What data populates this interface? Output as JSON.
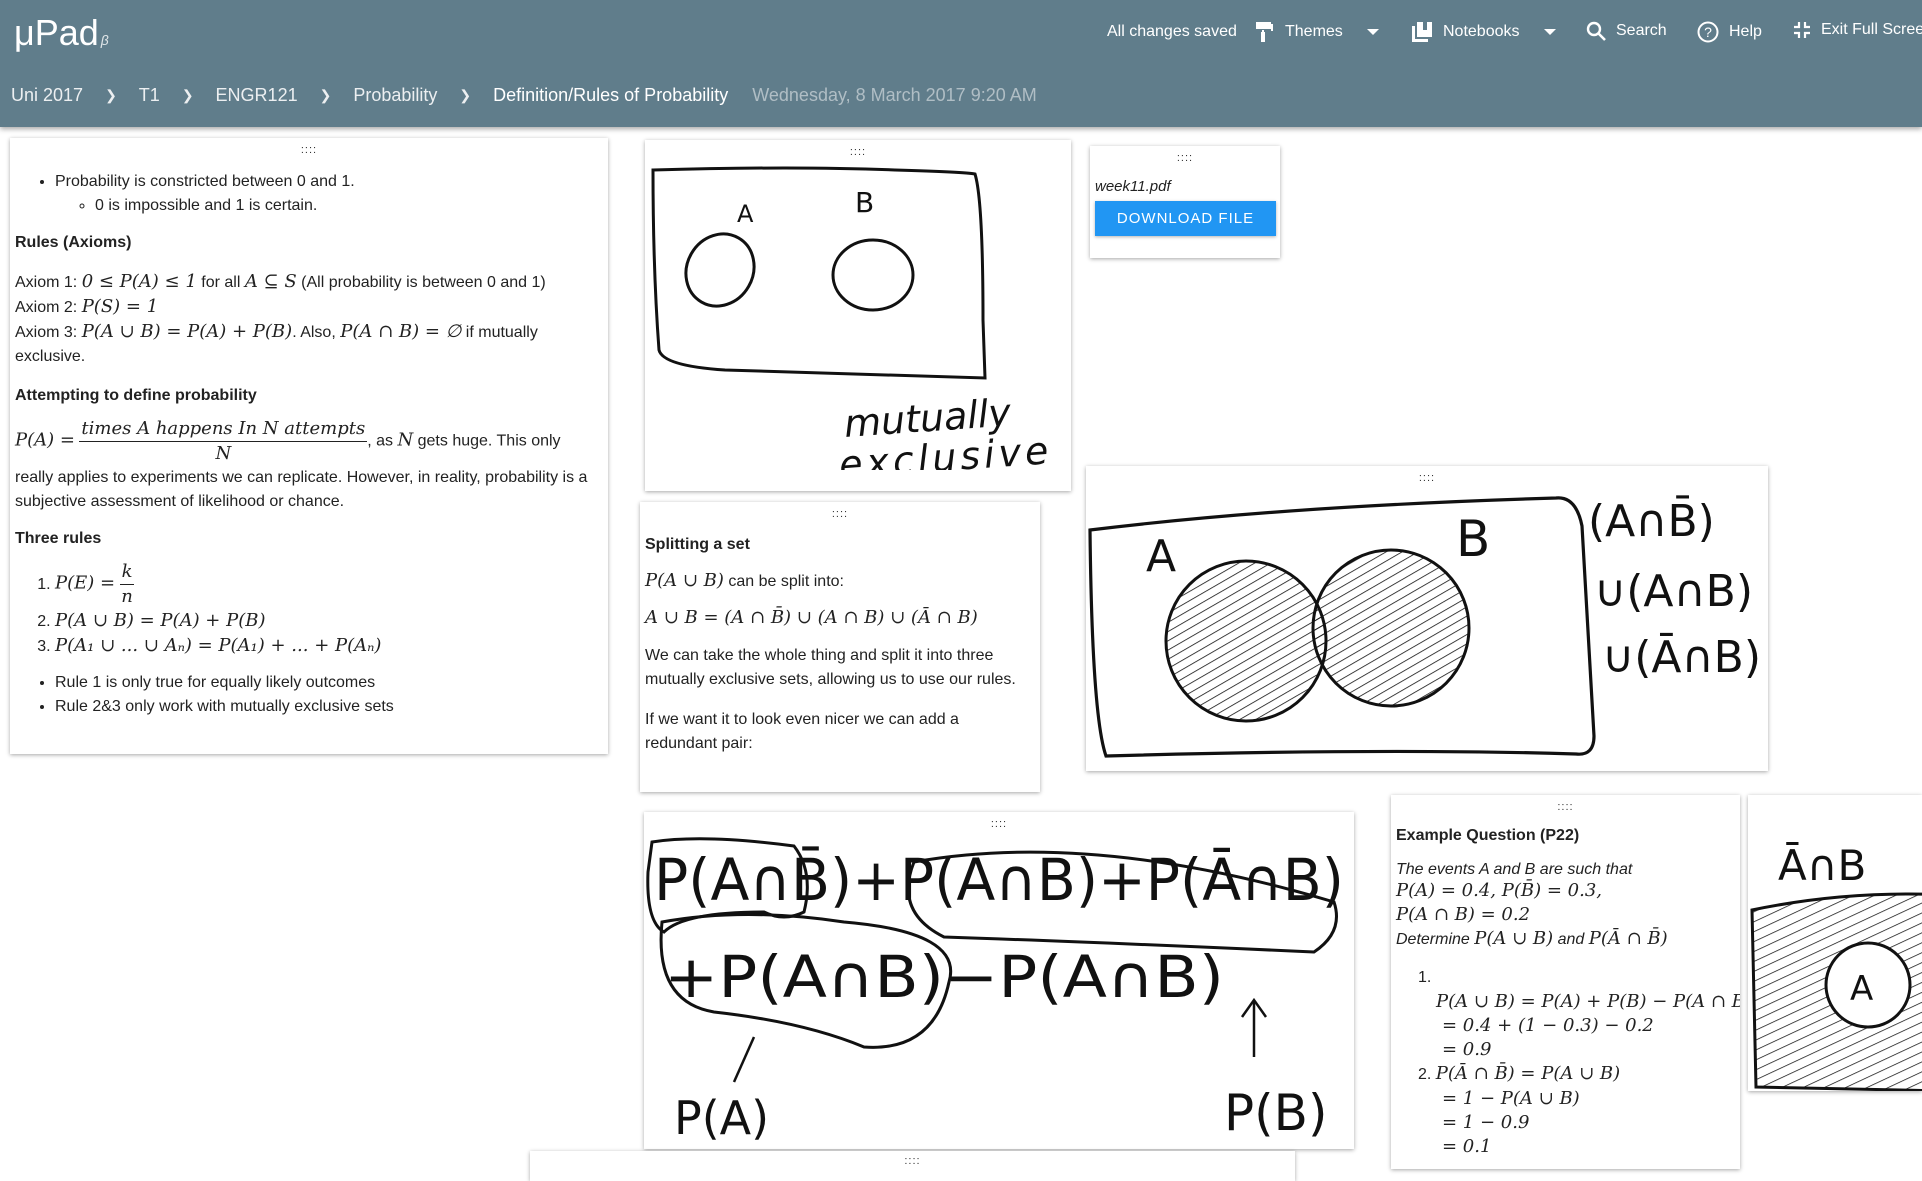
{
  "app": {
    "logo": "μPad",
    "beta": "β",
    "status": "All changes saved"
  },
  "toolbar": {
    "themes": "Themes",
    "notebooks": "Notebooks",
    "search": "Search",
    "help": "Help",
    "exit_fullscreen": "Exit Full Screen"
  },
  "breadcrumb": {
    "items": [
      "Uni 2017",
      "T1",
      "ENGR121",
      "Probability",
      "Definition/Rules of Probability"
    ],
    "date": "Wednesday, 8 March 2017 9:20 AM"
  },
  "handle": "::::",
  "notes": {
    "main": {
      "bullet1": "Probability is constricted between 0 and 1.",
      "bullet1_sub": "0 is impossible and 1 is certain.",
      "rules_heading": "Rules (Axioms)",
      "axiom1_prefix": "Axiom 1: ",
      "axiom1_math": "0 ≤ P(A) ≤ 1",
      "axiom1_mid": " for all ",
      "axiom1_math2": "A ⊆ S",
      "axiom1_suffix": " (All probability is between 0 and 1)",
      "axiom2_prefix": "Axiom 2: ",
      "axiom2_math": "P(S) = 1",
      "axiom3_prefix": "Axiom 3: ",
      "axiom3_math": "P(A ∪ B) = P(A) + P(B)",
      "axiom3_mid": ". Also, ",
      "axiom3_math2": "P(A ∩ B) = ∅",
      "axiom3_suffix": " if mutually exclusive.",
      "define_heading": "Attempting to define probability",
      "define_lhs": "P(A) =",
      "define_num": "times A happens In N attempts",
      "define_den": "N",
      "define_text1": ", as ",
      "define_n": "N",
      "define_text2": " gets huge. This only really applies to experiments we can replicate. However, in reality, probability is a subjective assessment of likelihood or chance.",
      "three_rules_heading": "Three rules",
      "rule1_lhs": "P(E) =",
      "rule1_num": "k",
      "rule1_den": "n",
      "rule2": "P(A ∪ B) = P(A) + P(B)",
      "rule3": "P(A₁ ∪ ... ∪ Aₙ) = P(A₁) + ... + P(Aₙ)",
      "bullet2": "Rule 1 is only true for equally likely outcomes",
      "bullet3": "Rule 2&3 only work with mutually exclusive sets"
    },
    "file": {
      "name": "week11.pdf",
      "button": "DOWNLOAD FILE"
    },
    "splitting": {
      "heading": "Splitting a set",
      "line1_math": "P(A ∪ B)",
      "line1_text": " can be split into:",
      "line2_math": "A ∪ B = (A ∩ B̄) ∪ (A ∩ B) ∪ (Ā ∩ B)",
      "para1": "We can take the whole thing and split it into three mutually exclusive sets, allowing us to use our rules.",
      "para2": "If we want it to look even nicer we can add a redundant pair:"
    },
    "example": {
      "heading": "Example Question (P22)",
      "intro": "The events A and B are such that",
      "given1": "P(A) = 0.4, P(B̄) = 0.3,",
      "given2": "P(A ∩ B) = 0.2",
      "determine_text": "Determine ",
      "determine_math1": "P(A ∪ B)",
      "determine_and": " and ",
      "determine_math2": "P(Ā ∩ B̄)",
      "item1_label": "1.",
      "item1_line1": "P(A ∪ B) = P(A) + P(B) − P(A ∩ B)",
      "item1_line2": "= 0.4 + (1 − 0.3) − 0.2",
      "item1_line3": "= 0.9",
      "item2_label": "2.",
      "item2_line1": "P(Ā ∩ B̄) = P(A ∪ B)",
      "item2_line2": "= 1 − P(A ∪ B)",
      "item2_line3": "= 1 − 0.9",
      "item2_line4": "= 0.1"
    },
    "drawings": {
      "venn_label_a": "A",
      "venn_label_b": "B",
      "venn_caption1": "mutually",
      "venn_caption2": "exclusive",
      "split_label_a": "A",
      "split_label_b": "B",
      "split_side1": "(A∩B̄)",
      "split_side2": "∪(A∩B)",
      "split_side3": "∪(Ā∩B)",
      "eq_line1": "P(A∩B̄)+P(A∩B)+P(Ā∩B)",
      "eq_line2": "+P(A∩B)−P(A∩B)",
      "eq_pa": "P(A)",
      "eq_pb": "P(B)",
      "edge_label": "Ā∩B",
      "edge_a": "A"
    }
  }
}
